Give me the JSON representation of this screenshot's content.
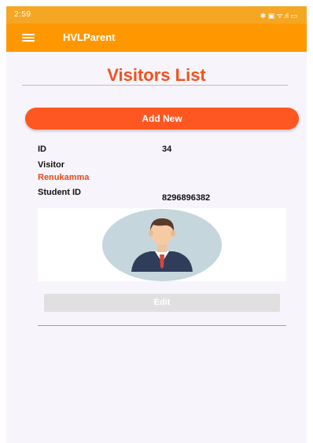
{
  "status_bar": {
    "time": "2:59",
    "indicators": "✱ ▣ ᯤ.ıl ▭"
  },
  "app_bar": {
    "title": "HVLParent",
    "menu_icon": "hamburger-menu-icon"
  },
  "page": {
    "title": "Visitors List"
  },
  "actions": {
    "add_new_label": "Add New",
    "edit_label": "Edit"
  },
  "visitor": {
    "id_label": "ID",
    "id_value": "34",
    "visitor_label": "Visitor",
    "visitor_name": "Renukamma",
    "student_id_label": "Student ID",
    "student_id_value": "8296896382",
    "photo_icon": "person-avatar-icon"
  },
  "colors": {
    "status_bar": "#f5a623",
    "app_bar": "#ff9800",
    "accent": "#f4511e",
    "button": "#ff5722",
    "edit_disabled": "#e0e0e0"
  }
}
